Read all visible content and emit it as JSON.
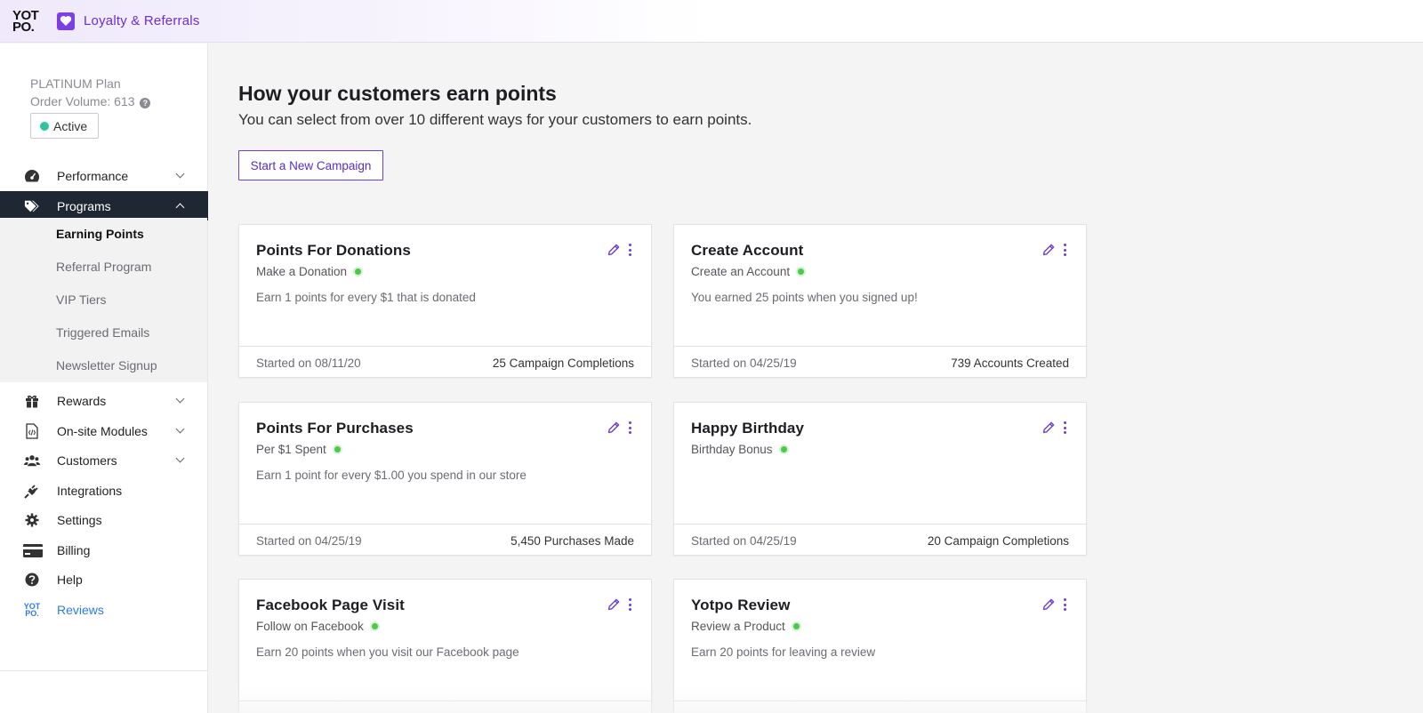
{
  "header": {
    "logo_line1": "YOT",
    "logo_line2": "PO.",
    "app_icon": "heart-icon",
    "app_title": "Loyalty & Referrals"
  },
  "account": {
    "plan": "PLATINUM Plan",
    "order_volume": "Order Volume: 613",
    "status": "Active"
  },
  "nav": {
    "performance": "Performance",
    "programs": "Programs",
    "sub": {
      "earning": "Earning Points",
      "referral": "Referral Program",
      "vip": "VIP Tiers",
      "emails": "Triggered Emails",
      "newsletter": "Newsletter Signup"
    },
    "rewards": "Rewards",
    "onsite": "On-site Modules",
    "customers": "Customers",
    "integrations": "Integrations",
    "settings": "Settings",
    "billing": "Billing",
    "help": "Help",
    "reviews": "Reviews",
    "reviews_logo_line1": "YOT",
    "reviews_logo_line2": "PO."
  },
  "main": {
    "title": "How your customers earn points",
    "subtitle": "You can select from over 10 different ways for your customers to earn points.",
    "new_campaign": "Start a New Campaign",
    "cards": [
      {
        "title": "Points For Donations",
        "subtitle": "Make a Donation",
        "desc": "Earn 1 points for every $1 that is donated",
        "started": "Started on 08/11/20",
        "metric": "25 Campaign Completions"
      },
      {
        "title": "Create Account",
        "subtitle": "Create an Account",
        "desc": "You earned 25 points when you signed up!",
        "started": "Started on 04/25/19",
        "metric": "739 Accounts Created"
      },
      {
        "title": "Points For Purchases",
        "subtitle": "Per $1 Spent",
        "desc": "Earn 1 point for every $1.00 you spend in our store",
        "started": "Started on 04/25/19",
        "metric": "5,450 Purchases Made"
      },
      {
        "title": "Happy Birthday",
        "subtitle": "Birthday Bonus",
        "desc": "",
        "started": "Started on 04/25/19",
        "metric": "20 Campaign Completions"
      },
      {
        "title": "Facebook Page Visit",
        "subtitle": "Follow on Facebook",
        "desc": "Earn 20 points when you visit our Facebook page",
        "started": "",
        "metric": ""
      },
      {
        "title": "Yotpo Review",
        "subtitle": "Review a Product",
        "desc": "Earn 20 points for leaving a review",
        "started": "",
        "metric": ""
      }
    ]
  },
  "colors": {
    "brand_purple": "#6a3fd8",
    "active_green": "#2ec4a0",
    "selected_nav_bg": "#1f2733",
    "reviews_blue": "#2b7be4"
  }
}
